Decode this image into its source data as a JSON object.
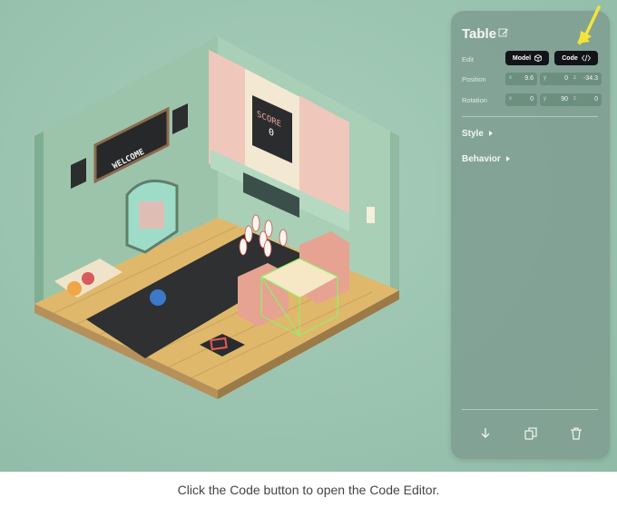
{
  "panel": {
    "title": "Table",
    "edit_label": "Edit",
    "model_button": "Model",
    "code_button": "Code",
    "position_label": "Position",
    "rotation_label": "Rotation",
    "position": {
      "x": "9.6",
      "y": "0",
      "z": "-34.3"
    },
    "rotation": {
      "x": "0",
      "y": "90",
      "z": "0"
    },
    "axis": {
      "x": "x",
      "y": "y",
      "z": "z"
    },
    "style_label": "Style",
    "behavior_label": "Behavior"
  },
  "scene": {
    "welcome_sign": "WELCOME",
    "score_label": "SCORE",
    "score_value": "0"
  },
  "icons": {
    "title_edit": "pencil-square-icon",
    "model": "cube-icon",
    "code": "code-brackets-icon",
    "footer": [
      "arrow-down-icon",
      "duplicate-icon",
      "trash-icon"
    ]
  },
  "colors": {
    "panel_bg": "#80a092",
    "background": "#9bc4b0",
    "highlight_arrow": "#f2e43a",
    "selection_outline": "#8ff06a"
  },
  "caption": "Click the Code button to open the Code Editor."
}
